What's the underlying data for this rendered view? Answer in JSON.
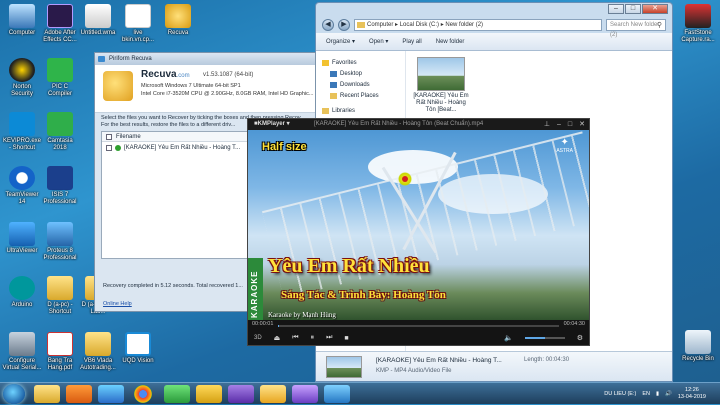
{
  "desktop_icons": [
    {
      "label": "Computer"
    },
    {
      "label": "Adobe After Effects CC..."
    },
    {
      "label": "Untitled.wma"
    },
    {
      "label": "live bkin.vn.cp..."
    },
    {
      "label": "Recuva"
    },
    {
      "label": "Norton Security"
    },
    {
      "label": "PIC C Compiler"
    },
    {
      "label": "KEVIPRO.exe - Shortcut"
    },
    {
      "label": "Camtasia 2018"
    },
    {
      "label": "TeamViewer 14"
    },
    {
      "label": "ISIS 7 Professional"
    },
    {
      "label": "UltraViewer"
    },
    {
      "label": "Proteus 8 Professional"
    },
    {
      "label": "Arduino"
    },
    {
      "label": "D (a-pc) - Shortcut"
    },
    {
      "label": "D (a-pc) Gift Lau..."
    },
    {
      "label": "Configure Virtual Serial..."
    },
    {
      "label": "Bang Tra Hang.pdf"
    },
    {
      "label": "VB6 Vlada Autotrading..."
    },
    {
      "label": "UQD Vision"
    },
    {
      "label": "FastStone Capture.ra..."
    },
    {
      "label": "Recycle Bin"
    }
  ],
  "explorer": {
    "breadcrumb": "Computer ▸ Local Disk (C:) ▸ New folder (2)",
    "search_placeholder": "Search New folder (2)",
    "toolbar": {
      "organize": "Organize ▾",
      "open": "Open ▾",
      "play_all": "Play all",
      "new_folder": "New folder"
    },
    "nav": {
      "favorites": "Favorites",
      "desktop": "Desktop",
      "downloads": "Downloads",
      "recent": "Recent Places",
      "libraries": "Libraries"
    },
    "file_tile": "[KARAOKE] Yêu Em Rất Nhiều - Hoàng Tôn [Beat...",
    "details": {
      "name": "[KARAOKE] Yêu Em Rất Nhiều - Hoàng T...",
      "length_label": "Length: 00:04:30",
      "sub": "KMP - MP4 Audio/Video File"
    }
  },
  "recuva": {
    "title": "Piriform Recuva",
    "brand": "Recuva",
    "brand_suffix": ".com",
    "version": "v1.53.1087 (64-bit)",
    "sys1": "Microsoft Windows 7 Ultimate 64-bit SP1",
    "sys2": "Intel Core i7-3520M CPU @ 2.90GHz, 8.0GB RAM, Intel HD Graphic...",
    "instructions": "Select the files you want to Recover by ticking the boxes and then pressing Recov...",
    "instructions2": "For the best results, restore the files to a different driv...",
    "col_filename": "Filename",
    "row_file": "[KARAOKE] Yêu Em Rất Nhiều - Hoàng T...",
    "status": "Recovery completed in 5.12 seconds. Total recovered 1...",
    "help": "Online Help"
  },
  "kmplayer": {
    "logo": "■KMPlayer ▾",
    "title": "[KARAOKE] Yêu Em Rất Nhiều - Hoàng Tôn (Beat Chuẩn).mp4",
    "overlay_halfsize": "Half size",
    "channel": "ASTRA",
    "side_label": "KARAOKE",
    "song_title": "Yêu Em Rất Nhiều",
    "song_sub": "Sáng Tác & Trình Bày:  Hoàng Tôn",
    "song_by": "Karaoke by Mạnh Hùng",
    "time_current": "00:00:01",
    "time_total": "00:04:30",
    "format": "3D",
    "progress_fraction": 0.004,
    "volume_fraction": 0.5
  },
  "taskbar": {
    "language": "DU LIEU (E:)",
    "lang_code": "EN",
    "time": "12:26",
    "date": "13-04-2019"
  }
}
